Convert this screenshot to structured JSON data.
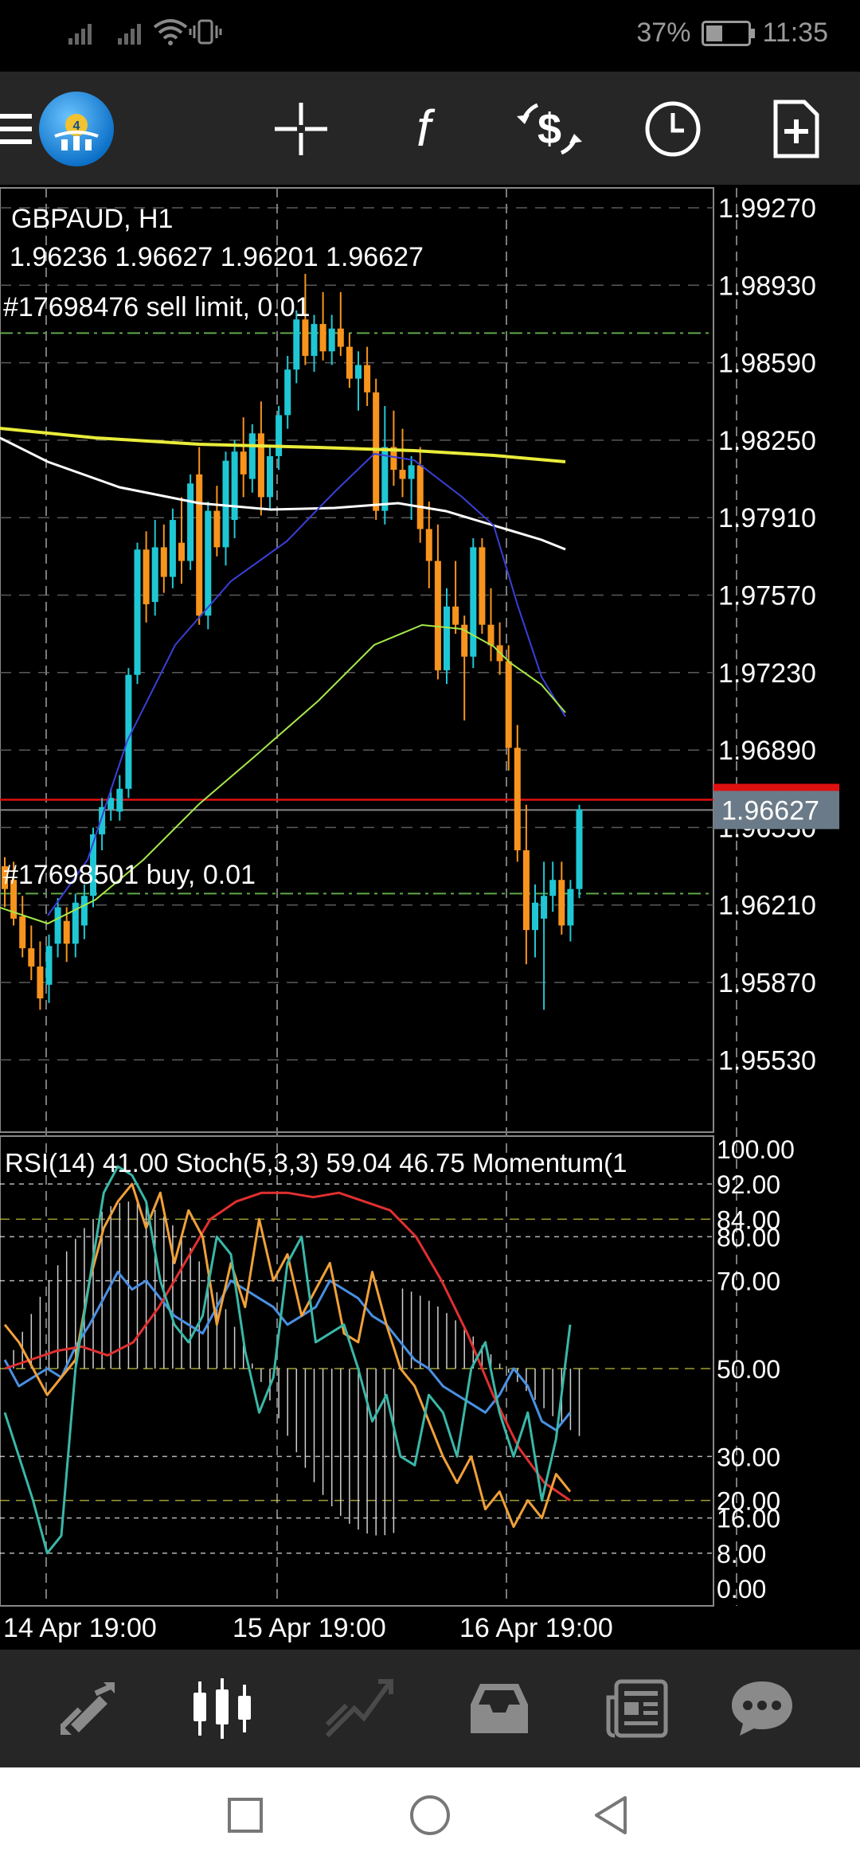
{
  "status_bar": {
    "battery": "37%",
    "time": "11:35"
  },
  "toolbar": {
    "icons": [
      "menu-icon",
      "app-logo-icon",
      "crosshair-icon",
      "indicators-icon",
      "trade-icon",
      "period-icon",
      "new-order-icon"
    ]
  },
  "chart": {
    "symbol_line": "GBPAUD, H1",
    "ohlc_line": "1.96236 1.96627 1.96201 1.96627",
    "sell_order": "#17698476 sell limit, 0.01",
    "buy_order": "#17698501 buy, 0.01",
    "current_price": "1.96627",
    "red_line_price": "1.96672",
    "price_axis": [
      "1.99270",
      "1.98930",
      "1.98590",
      "1.98250",
      "1.97910",
      "1.97570",
      "1.97230",
      "1.96890",
      "1.96550",
      "1.96210",
      "1.95870",
      "1.95530"
    ],
    "indicator_header": "RSI(14) 41.00 Stoch(5,3,3) 59.04 46.75 Momentum(1",
    "indicator_axis": [
      "100.00",
      "92.00",
      "84.00",
      "80.00",
      "70.00",
      "50.00",
      "30.00",
      "20.00",
      "16.00",
      "8.00",
      "0.00"
    ],
    "time_axis": [
      "14 Apr 19:00",
      "15 Apr 19:00",
      "16 Apr 19:00"
    ],
    "colors": {
      "bull": "#1fc7d4",
      "bear": "#f7941d",
      "ma_yellow": "#e9ec3a",
      "ma_white": "#ffffff",
      "ma_blue": "#3a3fd8",
      "ma_green": "#a6e84a",
      "red_line": "#e01010",
      "price_tag": "#6b7a88"
    }
  },
  "bottom_nav": {
    "items": [
      "quotes-icon",
      "chart-icon",
      "trade-icon",
      "history-icon",
      "news-icon",
      "chat-icon"
    ],
    "active": "chart-icon"
  }
}
